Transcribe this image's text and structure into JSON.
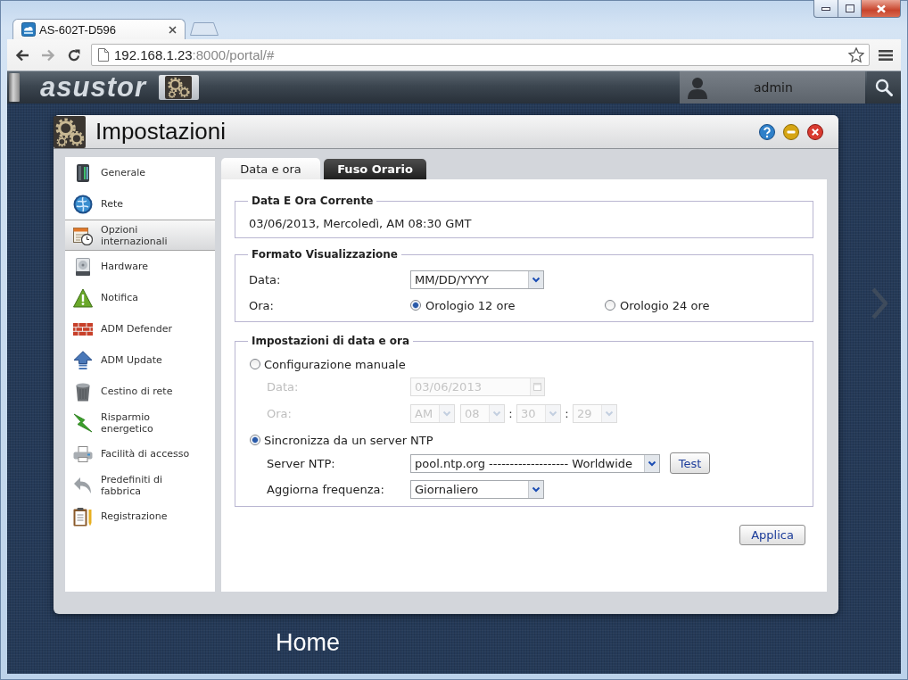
{
  "browser": {
    "tabs": [
      {
        "title": "AS-602T-D596",
        "selected": true
      }
    ],
    "address": {
      "host": "192.168.1.23",
      "path": ":8000/portal/#"
    }
  },
  "adm_bar": {
    "logo": "asustor",
    "user": "admin"
  },
  "window": {
    "title": "Impostazioni"
  },
  "sidebar": {
    "items": [
      {
        "label": "Generale",
        "kind": "server",
        "selected": false
      },
      {
        "label": "Rete",
        "kind": "globe",
        "selected": false
      },
      {
        "label": "Opzioni internazionali",
        "kind": "calendar",
        "selected": true
      },
      {
        "label": "Hardware",
        "kind": "drive",
        "selected": false
      },
      {
        "label": "Notifica",
        "kind": "warning",
        "selected": false
      },
      {
        "label": "ADM Defender",
        "kind": "wall",
        "selected": false
      },
      {
        "label": "ADM Update",
        "kind": "upload",
        "selected": false
      },
      {
        "label": "Cestino di rete",
        "kind": "trash",
        "selected": false
      },
      {
        "label": "Risparmio energetico",
        "kind": "bolt",
        "selected": false
      },
      {
        "label": "Facilità di accesso",
        "kind": "printer",
        "selected": false
      },
      {
        "label": "Predefiniti di fabbrica",
        "kind": "undo",
        "selected": false
      },
      {
        "label": "Registrazione",
        "kind": "clipboard",
        "selected": false
      }
    ]
  },
  "tabs": [
    {
      "label": "Data e ora",
      "selected": true
    },
    {
      "label": "Fuso Orario",
      "selected": false
    }
  ],
  "current_time": {
    "legend": "Data E Ora Corrente",
    "value": "03/06/2013, Mercoledì, AM 08:30 GMT"
  },
  "display_format": {
    "legend": "Formato Visualizzazione",
    "date_label": "Data:",
    "date_format": "MM/DD/YYYY",
    "time_label": "Ora:",
    "clock_options": [
      {
        "label": "Orologio 12 ore",
        "selected": true
      },
      {
        "label": "Orologio 24 ore",
        "selected": false
      }
    ]
  },
  "date_time_settings": {
    "legend": "Impostazioni di data e ora",
    "modes": [
      {
        "kind": "manual",
        "label": "Configurazione manuale",
        "selected": false,
        "disabled": true,
        "date_label": "Data:",
        "date": "03/06/2013",
        "time_label": "Ora:",
        "time_fields": [
          {
            "kind": "select",
            "value": "AM"
          },
          {
            "kind": "select",
            "value": "08"
          },
          {
            "kind": "separator",
            "value": ":"
          },
          {
            "kind": "select",
            "value": "30"
          },
          {
            "kind": "separator",
            "value": ":"
          },
          {
            "kind": "select",
            "value": "29"
          }
        ]
      },
      {
        "kind": "ntp",
        "label": "Sincronizza da un server NTP",
        "selected": true,
        "disabled": false,
        "server_label": "Server NTP:",
        "server": "pool.ntp.org ------------------- Worldwide",
        "test_button": "Test",
        "frequency_label": "Aggiorna frequenza:",
        "frequency": "Giornaliero"
      }
    ]
  },
  "apply_button": "Applica",
  "desktop": {
    "page_title": "Home"
  }
}
